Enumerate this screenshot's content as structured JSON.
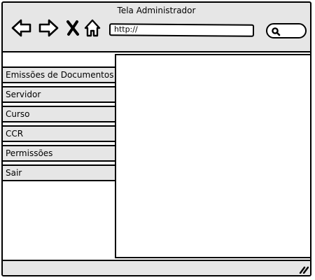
{
  "window": {
    "title": "Tela Administrador"
  },
  "toolbar": {
    "back_icon": "arrow-left-icon",
    "forward_icon": "arrow-right-icon",
    "stop_icon": "close-icon",
    "home_icon": "home-icon",
    "search_icon": "search-icon"
  },
  "address_bar": {
    "value": "http://"
  },
  "sidebar": {
    "items": [
      {
        "label": "Emissões de Documentos"
      },
      {
        "label": "Servidor"
      },
      {
        "label": "Curso"
      },
      {
        "label": "CCR"
      },
      {
        "label": "Permissões"
      },
      {
        "label": "Sair"
      }
    ]
  },
  "colors": {
    "chrome": "#e6e6e6",
    "border": "#000000",
    "content": "#ffffff"
  }
}
